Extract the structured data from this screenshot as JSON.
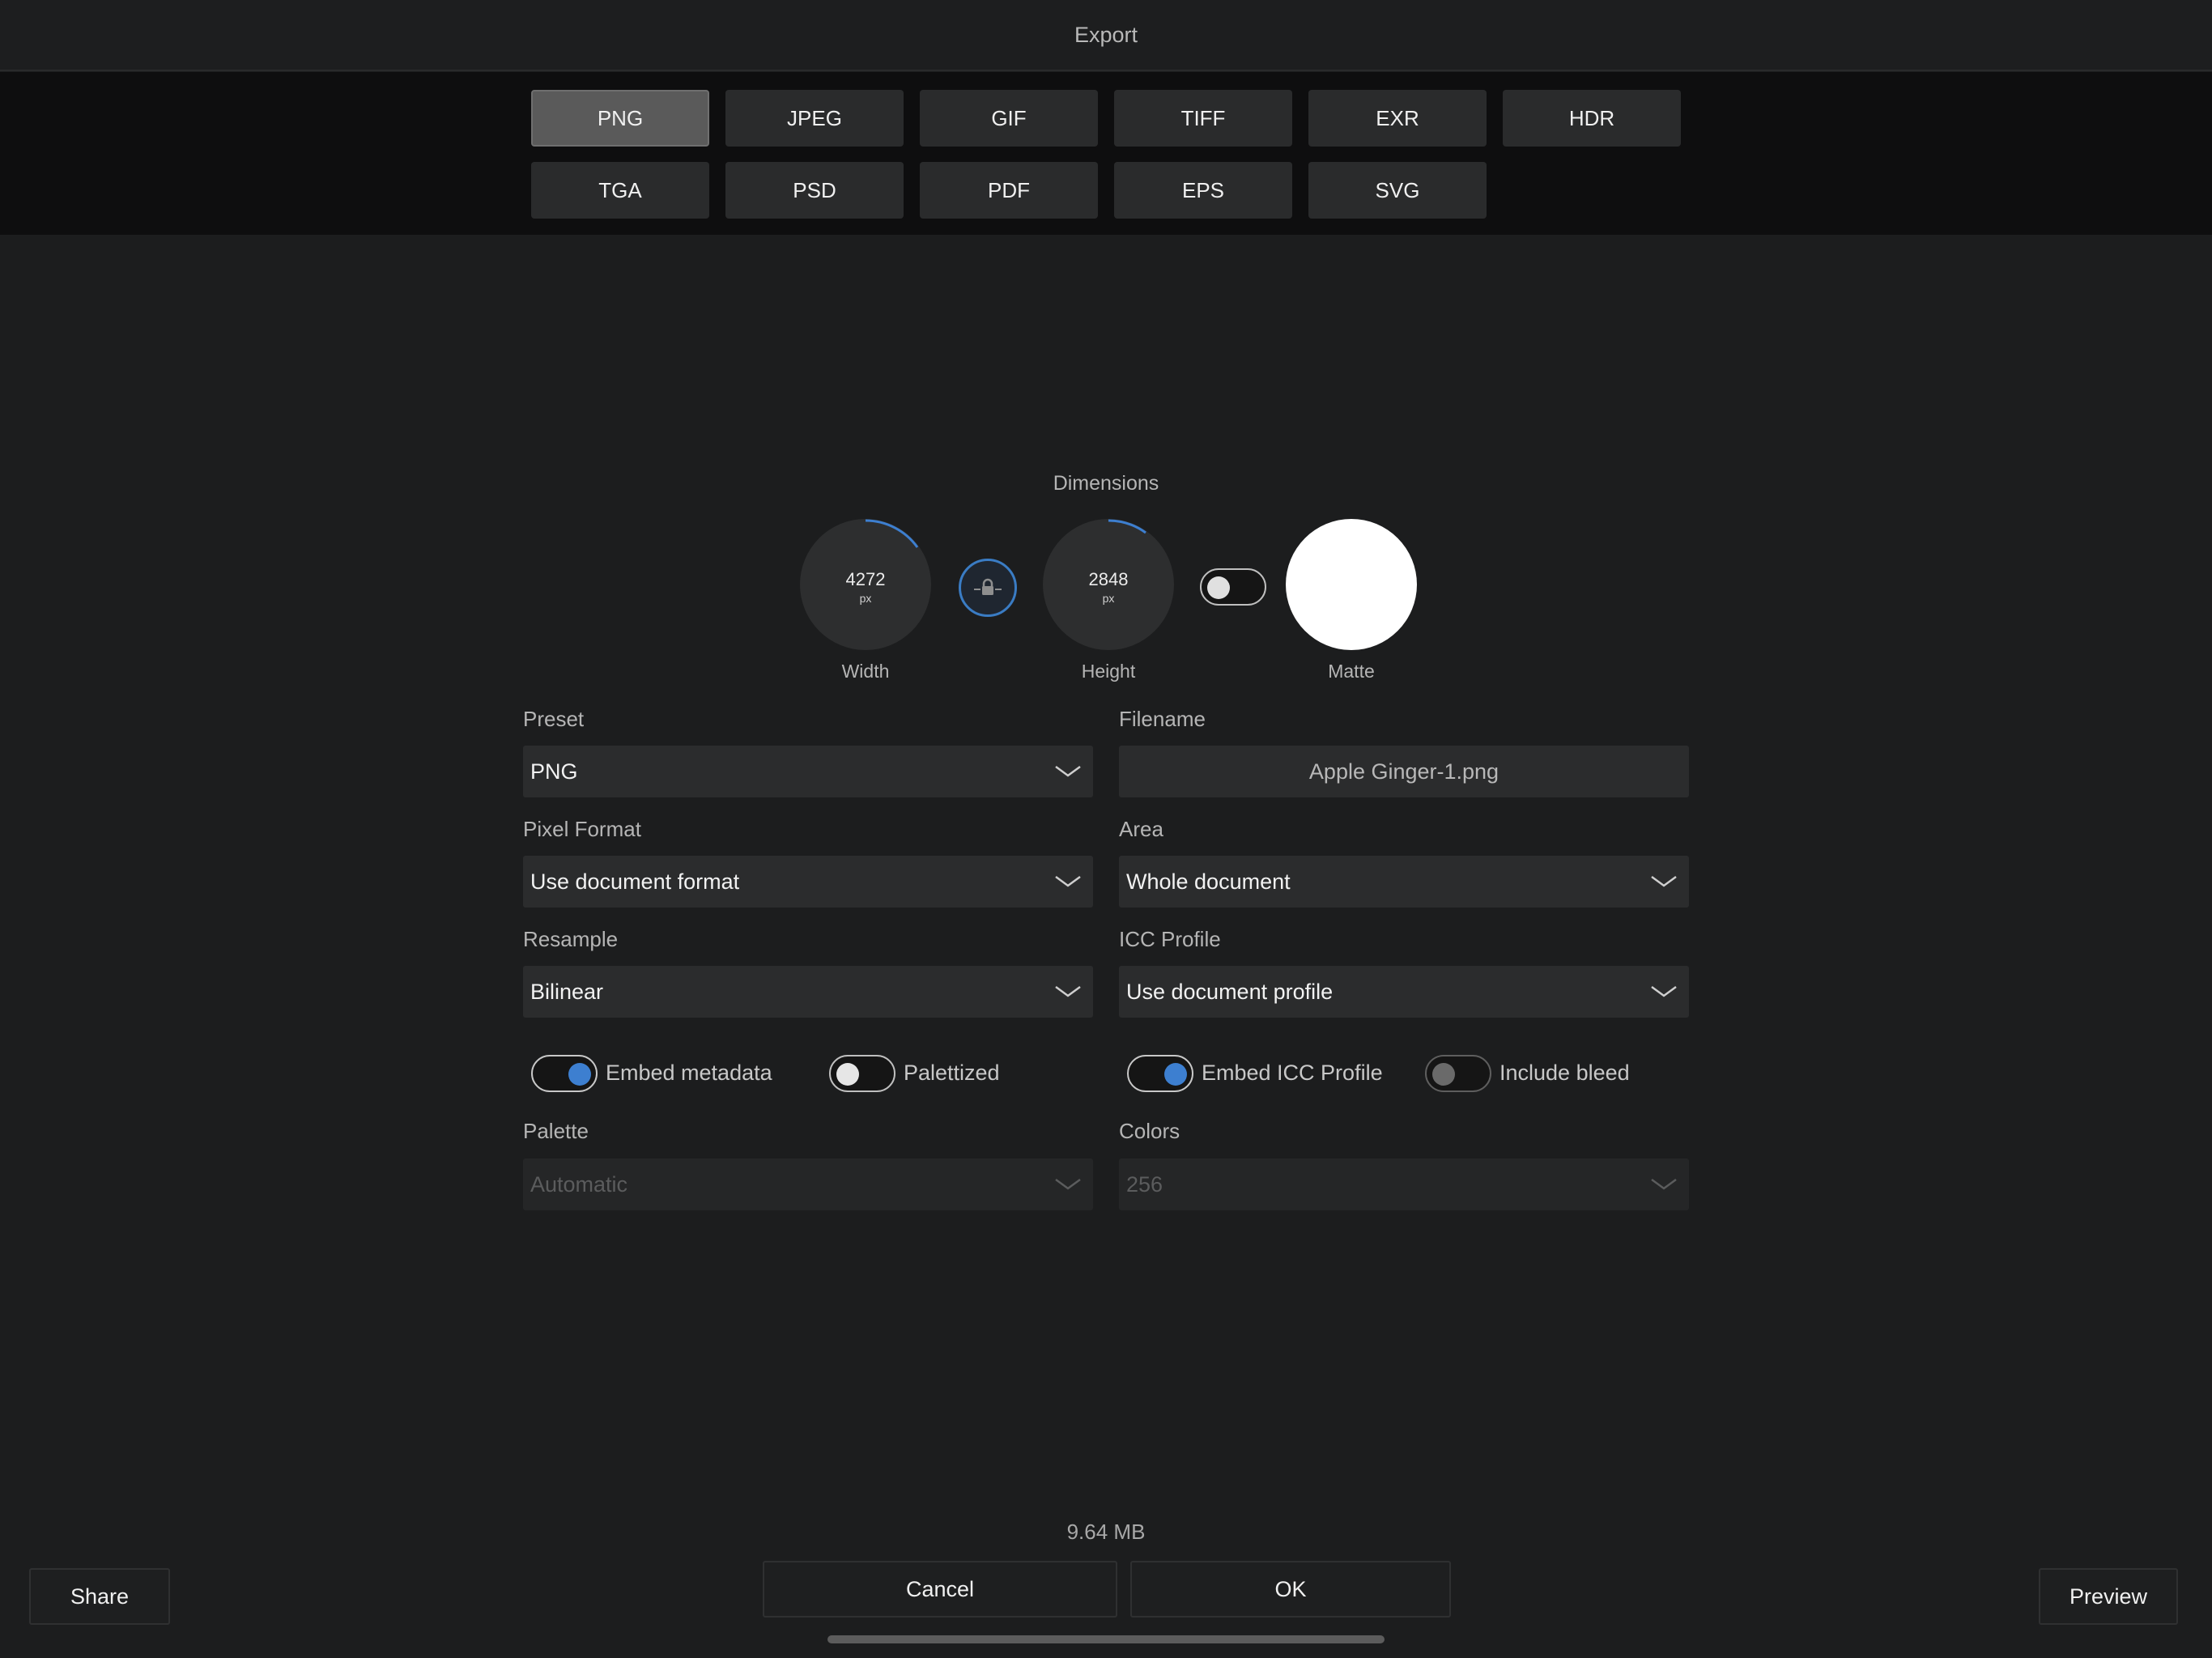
{
  "window": {
    "title": "Export"
  },
  "formats": {
    "selected": "PNG",
    "items": [
      "PNG",
      "JPEG",
      "GIF",
      "TIFF",
      "EXR",
      "HDR",
      "TGA",
      "PSD",
      "PDF",
      "EPS",
      "SVG"
    ]
  },
  "dimensions": {
    "title": "Dimensions",
    "width": {
      "value": "4272",
      "unit": "px",
      "label": "Width"
    },
    "height": {
      "value": "2848",
      "unit": "px",
      "label": "Height"
    },
    "lock_icon": "lock-icon",
    "matte": {
      "label": "Matte",
      "enabled": false,
      "color": "#ffffff"
    }
  },
  "form": {
    "preset": {
      "label": "Preset",
      "value": "PNG"
    },
    "filename": {
      "label": "Filename",
      "value": "Apple Ginger-1.png"
    },
    "pixel_format": {
      "label": "Pixel Format",
      "value": "Use document format"
    },
    "area": {
      "label": "Area",
      "value": "Whole document"
    },
    "resample": {
      "label": "Resample",
      "value": "Bilinear"
    },
    "icc_profile": {
      "label": "ICC Profile",
      "value": "Use document profile"
    },
    "palette": {
      "label": "Palette",
      "value": "Automatic"
    },
    "colors": {
      "label": "Colors",
      "value": "256"
    }
  },
  "toggles": {
    "embed_metadata": {
      "label": "Embed metadata",
      "on": true
    },
    "palettized": {
      "label": "Palettized",
      "on": false
    },
    "embed_icc": {
      "label": "Embed ICC Profile",
      "on": true
    },
    "include_bleed": {
      "label": "Include bleed",
      "on": false
    }
  },
  "footer": {
    "file_size": "9.64 MB",
    "share": "Share",
    "cancel": "Cancel",
    "ok": "OK",
    "preview": "Preview"
  },
  "colors": {
    "accent": "#3d7fd0",
    "background": "#1c1d1e"
  }
}
